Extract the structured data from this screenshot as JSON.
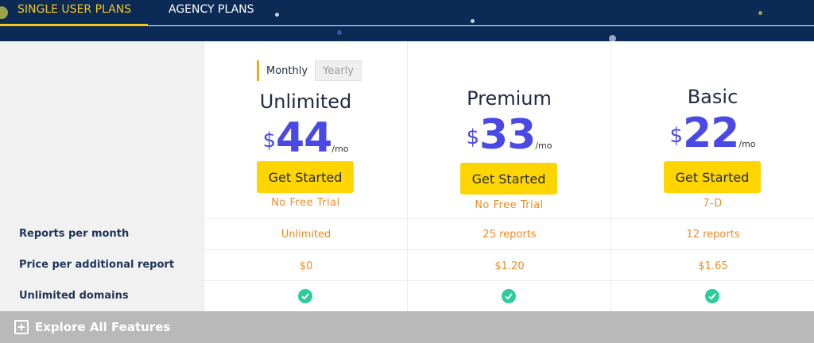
{
  "tabs": {
    "single": "SINGLE USER PLANS",
    "agency": "AGENCY PLANS"
  },
  "billing_toggle": {
    "monthly": "Monthly",
    "yearly": "Yearly"
  },
  "plans": [
    {
      "name": "Unlimited",
      "currency": "$",
      "amount": "44",
      "period": "/mo",
      "cta": "Get Started",
      "trial": "No Free Trial"
    },
    {
      "name": "Premium",
      "currency": "$",
      "amount": "33",
      "period": "/mo",
      "cta": "Get Started",
      "trial": "No Free Trial"
    },
    {
      "name": "Basic",
      "currency": "$",
      "amount": "22",
      "period": "/mo",
      "cta": "Get Started",
      "trial": "7-D"
    }
  ],
  "features": [
    {
      "label": "Reports per month",
      "values": [
        "Unlimited",
        "25 reports",
        "12 reports"
      ]
    },
    {
      "label": "Price per additional report",
      "values": [
        "$0",
        "$1.20",
        "$1.65"
      ]
    },
    {
      "label": "Unlimited domains",
      "values": [
        "check-icon",
        "check-icon",
        "check-icon"
      ]
    }
  ],
  "explore": "Explore All Features",
  "colors": {
    "accent": "#4b49e6",
    "cta": "#ffd500",
    "highlight": "#f08a24",
    "check": "#2ecc9a",
    "header": "#0b2a55"
  }
}
